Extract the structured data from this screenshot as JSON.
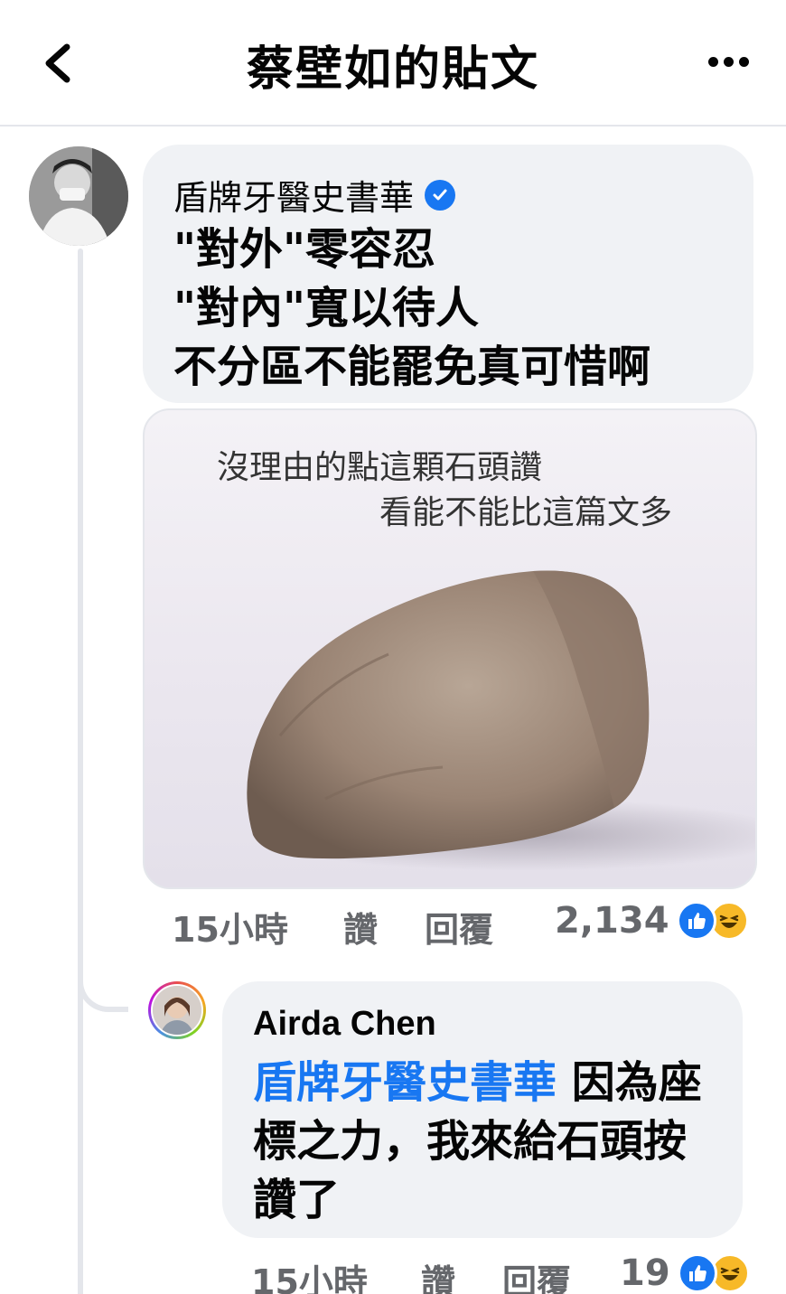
{
  "header": {
    "title": "蔡壁如的貼文"
  },
  "comment1": {
    "author": "盾牌牙醫史書華",
    "lines": [
      "\"對外\"零容忍",
      "\"對內\"寬以待人",
      "不分區不能罷免真可惜啊"
    ],
    "image_text": {
      "line1": "沒理由的點這顆石頭讚",
      "line2": "看能不能比這篇文多"
    },
    "time": "15小時",
    "like_label": "讚",
    "reply_label": "回覆",
    "reaction_count": "2,134"
  },
  "comment2": {
    "author": "Airda Chen",
    "mention": "盾牌牙醫史書華",
    "text_after_mention": " 因為座標之力，我來給石頭按讚了",
    "time": "15小時",
    "like_label": "讚",
    "reply_label": "回覆",
    "reaction_count": "19"
  },
  "icons": {
    "back": "chevron-left-icon",
    "more": "more-horizontal-icon",
    "verified": "verified-badge-icon",
    "like": "like-reaction-icon",
    "haha": "haha-reaction-icon"
  },
  "colors": {
    "accent": "#1877f2",
    "bubble": "#f0f2f5",
    "meta_text": "#65676b"
  }
}
